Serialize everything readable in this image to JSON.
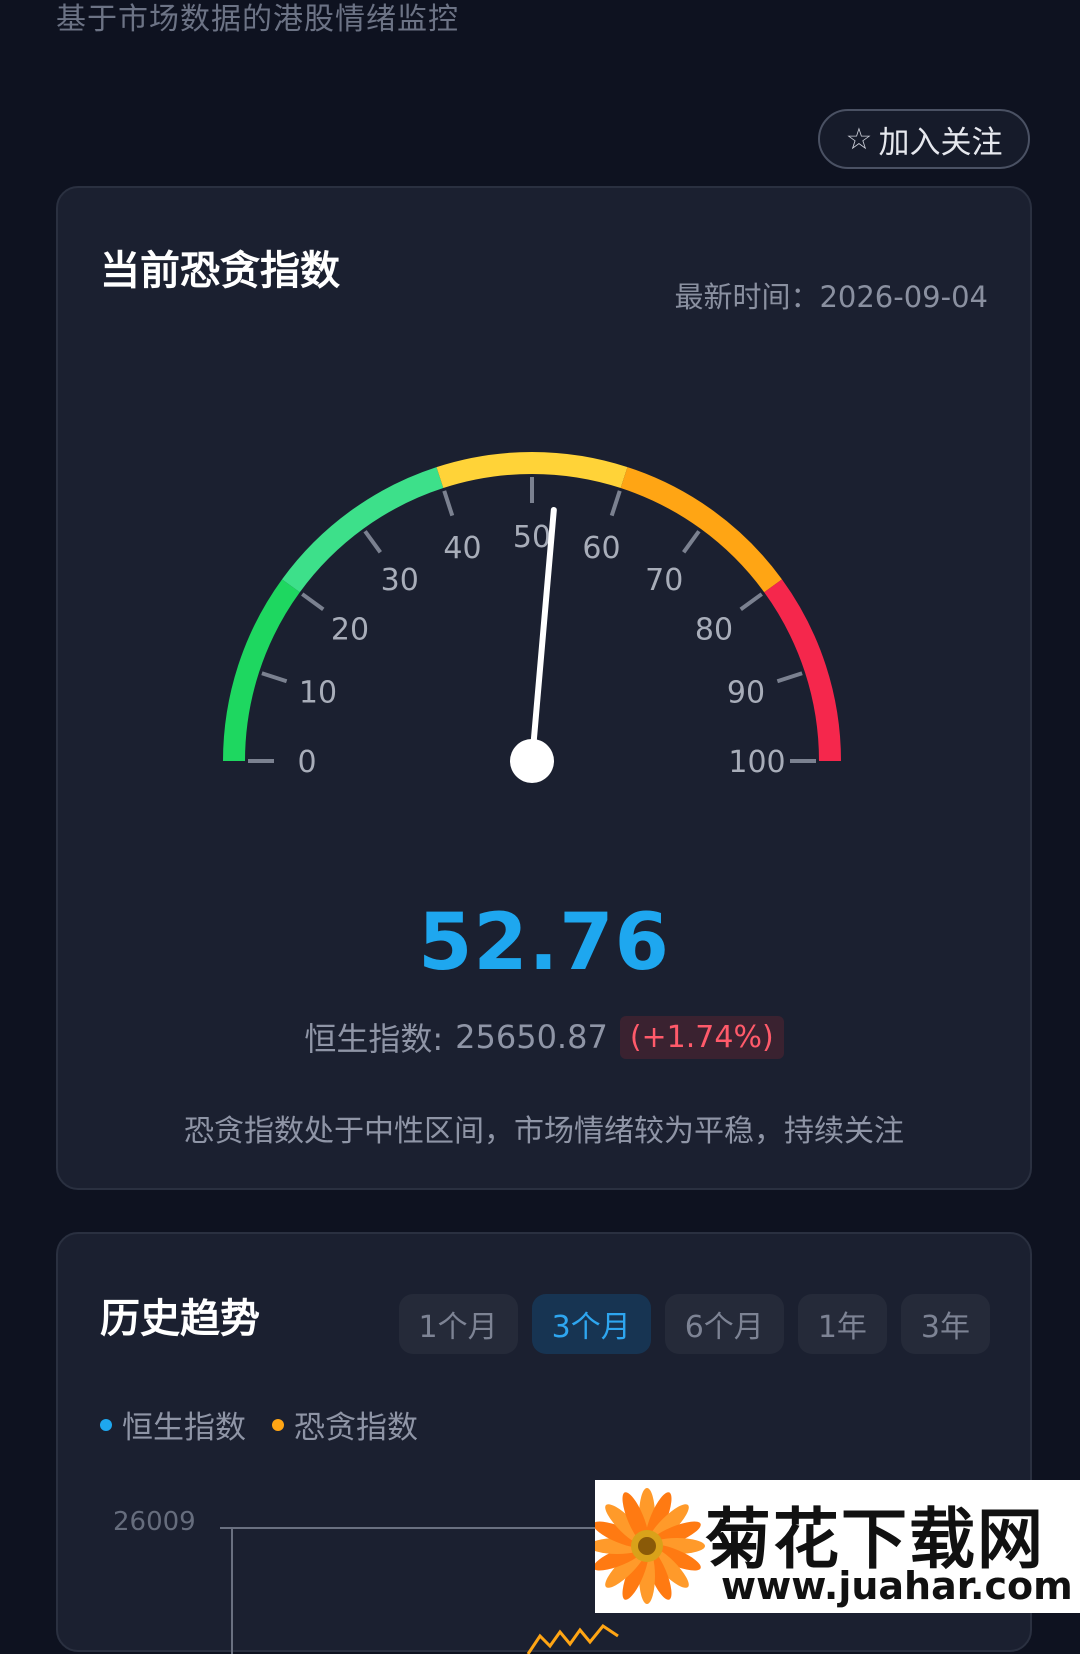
{
  "page": {
    "subtitle": "基于市场数据的港股情绪监控"
  },
  "actions": {
    "follow_label": "加入关注",
    "follow_icon": "star-outline-icon"
  },
  "gauge_card": {
    "title": "当前恐贪指数",
    "updated": "最新时间：2026-09-04",
    "index_value": 52.76,
    "index_value_text": "52.76",
    "ticks": [
      "0",
      "10",
      "20",
      "30",
      "40",
      "50",
      "60",
      "70",
      "80",
      "90",
      "100"
    ],
    "hsi_label": "恒生指数:",
    "hsi_value": "25650.87",
    "hsi_change": "(+1.74%)",
    "comment": "恐贪指数处于中性区间，市场情绪较为平稳，持续关注",
    "colors": {
      "extreme_fear": "#1ed760",
      "fear": "#3de08a",
      "neutral": "#ffd338",
      "greed": "#ffa514",
      "extreme_greed": "#f5274c",
      "value": "#1ea7ef"
    }
  },
  "history_card": {
    "title": "历史趋势",
    "tabs": [
      {
        "label": "1个月",
        "active": false
      },
      {
        "label": "3个月",
        "active": true
      },
      {
        "label": "6个月",
        "active": false
      },
      {
        "label": "1年",
        "active": false
      },
      {
        "label": "3年",
        "active": false
      }
    ],
    "legend": [
      {
        "label": "恒生指数",
        "color": "#1ea7ef"
      },
      {
        "label": "恐贪指数",
        "color": "#ffa514"
      }
    ],
    "y_axis_top": "26009"
  },
  "watermark": {
    "name": "菊花下载网",
    "url": "www.juahar.com"
  }
}
